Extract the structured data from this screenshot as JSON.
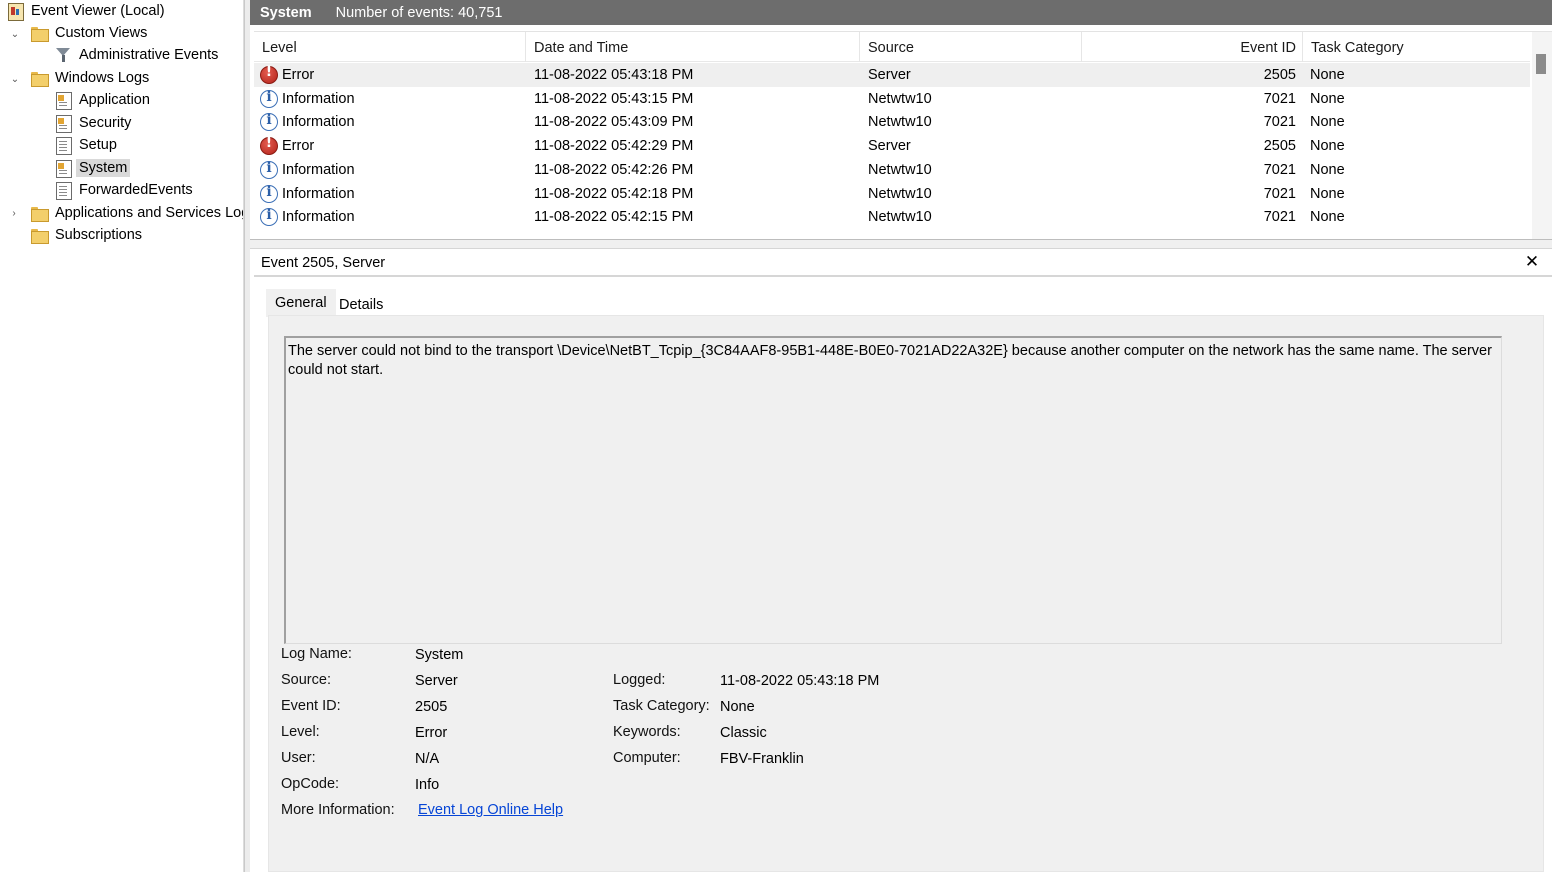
{
  "tree": {
    "root": "Event Viewer (Local)",
    "custom_views": "Custom Views",
    "administrative_events": "Administrative Events",
    "windows_logs": "Windows Logs",
    "application": "Application",
    "security": "Security",
    "setup": "Setup",
    "system": "System",
    "forwarded_events": "ForwardedEvents",
    "apps_services": "Applications and Services Logs",
    "subscriptions": "Subscriptions"
  },
  "header": {
    "log_name": "System",
    "event_count": "Number of events: 40,751"
  },
  "columns": {
    "level": "Level",
    "date_time": "Date and Time",
    "source": "Source",
    "event_id": "Event ID",
    "task_category": "Task Category"
  },
  "events": [
    {
      "level": "Error",
      "date": "11-08-2022 05:43:18 PM",
      "source": "Server",
      "id": "2505",
      "category": "None"
    },
    {
      "level": "Information",
      "date": "11-08-2022 05:43:15 PM",
      "source": "Netwtw10",
      "id": "7021",
      "category": "None"
    },
    {
      "level": "Information",
      "date": "11-08-2022 05:43:09 PM",
      "source": "Netwtw10",
      "id": "7021",
      "category": "None"
    },
    {
      "level": "Error",
      "date": "11-08-2022 05:42:29 PM",
      "source": "Server",
      "id": "2505",
      "category": "None"
    },
    {
      "level": "Information",
      "date": "11-08-2022 05:42:26 PM",
      "source": "Netwtw10",
      "id": "7021",
      "category": "None"
    },
    {
      "level": "Information",
      "date": "11-08-2022 05:42:18 PM",
      "source": "Netwtw10",
      "id": "7021",
      "category": "None"
    },
    {
      "level": "Information",
      "date": "11-08-2022 05:42:15 PM",
      "source": "Netwtw10",
      "id": "7021",
      "category": "None"
    }
  ],
  "detail": {
    "title": "Event 2505, Server",
    "tab_general": "General",
    "tab_details": "Details",
    "message": "The server could not bind to the transport \\Device\\NetBT_Tcpip_{3C84AAF8-95B1-448E-B0E0-7021AD22A32E} because another computer on the network has the same name.  The server could not start.",
    "labels": {
      "log_name": "Log Name:",
      "source": "Source:",
      "event_id": "Event ID:",
      "level": "Level:",
      "user": "User:",
      "opcode": "OpCode:",
      "more_info": "More Information:",
      "logged": "Logged:",
      "task_category": "Task Category:",
      "keywords": "Keywords:",
      "computer": "Computer:"
    },
    "values": {
      "log_name": "System",
      "source": "Server",
      "event_id": "2505",
      "level": "Error",
      "user": "N/A",
      "opcode": "Info",
      "more_info": "Event Log Online Help",
      "logged": "11-08-2022 05:43:18 PM",
      "task_category": "None",
      "keywords": "Classic",
      "computer": "FBV-Franklin"
    }
  }
}
